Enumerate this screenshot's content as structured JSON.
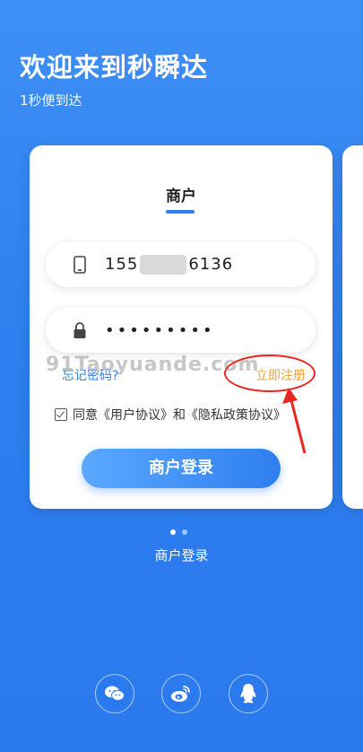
{
  "header": {
    "title": "欢迎来到秒瞬达",
    "subtitle": "1秒便到达"
  },
  "card": {
    "tab_title": "商户",
    "phone": {
      "prefix": "155",
      "suffix": "6136",
      "icon": "phone-icon"
    },
    "password": {
      "masked": "•••••••••",
      "icon": "lock-icon"
    },
    "forgot_label": "忘记密码?",
    "register_label": "立即注册",
    "watermark": "91Taoyuande.com",
    "agreement_label": "同意《用户协议》和《隐私政策协议》",
    "login_button": "商户登录"
  },
  "carousel": {
    "active_index": 0,
    "count": 2,
    "label": "商户登录"
  },
  "social": [
    "wechat-icon",
    "weibo-icon",
    "qq-icon"
  ],
  "colors": {
    "primary": "#2f7ff0",
    "accent": "#f0a13a",
    "annotation": "#e8281f"
  }
}
